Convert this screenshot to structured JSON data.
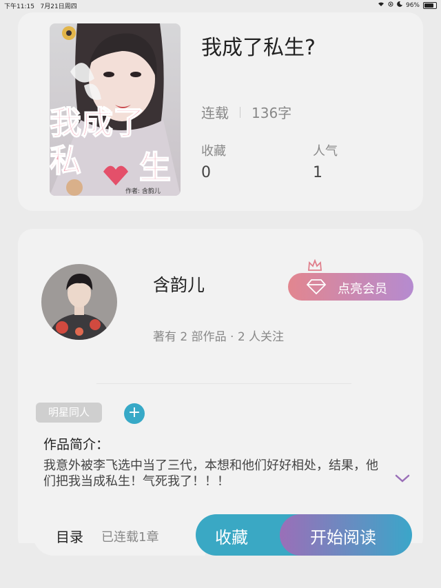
{
  "status_bar": {
    "time": "下午11:15",
    "date": "7月21日周四",
    "battery": "96%",
    "battery_level": 0.96
  },
  "book": {
    "title": "我成了私生?",
    "status": "连载",
    "word_count": "136字",
    "cover_text": [
      "我成了",
      "私",
      "生"
    ],
    "cover_author": "作者: 含韵儿",
    "stats": [
      {
        "label": "收藏",
        "value": "0"
      },
      {
        "label": "人气",
        "value": "1"
      }
    ]
  },
  "author": {
    "name": "含韵儿",
    "meta": "著有 2 部作品 · 2 人关注",
    "vip_button": "点亮会员"
  },
  "tags": [
    "明星同人"
  ],
  "intro": {
    "heading": "作品简介：",
    "text": "我意外被李飞选中当了三代，本想和他们好好相处，结果，他们把我当成私生！气死我了！！！"
  },
  "bottom_bar": {
    "toc": "目录",
    "chapters": "已连载1章",
    "favorite": "收藏",
    "read": "开始阅读"
  },
  "colors": {
    "accent": "#3aa8c4",
    "vip": "#e2868f",
    "purple": "#9a6fb8"
  }
}
